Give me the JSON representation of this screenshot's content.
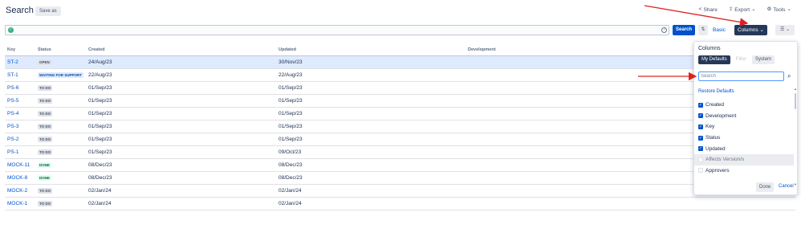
{
  "header": {
    "title": "Search",
    "save_as": "Save as"
  },
  "top_links": {
    "share": "Share",
    "export": "Export",
    "tools": "Tools"
  },
  "toolbar": {
    "search": "Search",
    "basic": "Basic",
    "columns": "Columns",
    "filter_icon": "sort-filter-icon",
    "layout_icon": "list-layout-icon"
  },
  "table": {
    "headers": {
      "key": "Key",
      "status": "Status",
      "created": "Created",
      "updated": "Updated",
      "development": "Development"
    },
    "rows": [
      {
        "key": "ST-2",
        "status": "OPEN",
        "tone": "default",
        "created": "24/Aug/23",
        "updated": "30/Nov/23",
        "selected": true
      },
      {
        "key": "ST-1",
        "status": "WAITING FOR SUPPORT",
        "tone": "blue",
        "created": "22/Aug/23",
        "updated": "22/Aug/23"
      },
      {
        "key": "PS-6",
        "status": "TO DO",
        "tone": "default",
        "created": "01/Sep/23",
        "updated": "01/Sep/23"
      },
      {
        "key": "PS-5",
        "status": "TO DO",
        "tone": "default",
        "created": "01/Sep/23",
        "updated": "01/Sep/23"
      },
      {
        "key": "PS-4",
        "status": "TO DO",
        "tone": "default",
        "created": "01/Sep/23",
        "updated": "01/Sep/23"
      },
      {
        "key": "PS-3",
        "status": "TO DO",
        "tone": "default",
        "created": "01/Sep/23",
        "updated": "01/Sep/23"
      },
      {
        "key": "PS-2",
        "status": "TO DO",
        "tone": "default",
        "created": "01/Sep/23",
        "updated": "01/Sep/23"
      },
      {
        "key": "PS-1",
        "status": "TO DO",
        "tone": "default",
        "created": "01/Sep/23",
        "updated": "09/Oct/23"
      },
      {
        "key": "MOCK-11",
        "status": "DONE",
        "tone": "green",
        "created": "08/Dec/23",
        "updated": "08/Dec/23"
      },
      {
        "key": "MOCK-8",
        "status": "DONE",
        "tone": "green",
        "created": "08/Dec/23",
        "updated": "08/Dec/23"
      },
      {
        "key": "MOCK-2",
        "status": "TO DO",
        "tone": "default",
        "created": "02/Jan/24",
        "updated": "02/Jan/24"
      },
      {
        "key": "MOCK-1",
        "status": "TO DO",
        "tone": "default",
        "created": "02/Jan/24",
        "updated": "02/Jan/24"
      }
    ]
  },
  "columns_panel": {
    "heading": "Columns",
    "tabs": [
      "My Defaults",
      "Filter",
      "System"
    ],
    "search_placeholder": "Search",
    "restore": "Restore Defaults",
    "options": [
      {
        "label": "Created",
        "checked": true
      },
      {
        "label": "Development",
        "checked": true
      },
      {
        "label": "Key",
        "checked": true
      },
      {
        "label": "Status",
        "checked": true
      },
      {
        "label": "Updated",
        "checked": true
      },
      {
        "label": "Affects Version/s",
        "checked": false
      },
      {
        "label": "Approvers",
        "checked": false
      }
    ],
    "done": "Done",
    "cancel": "Cancel"
  },
  "colors": {
    "accent": "#0052cc",
    "dark_button": "#253858",
    "annotation_arrow": "#e02020",
    "selected_row": "#deebff"
  }
}
